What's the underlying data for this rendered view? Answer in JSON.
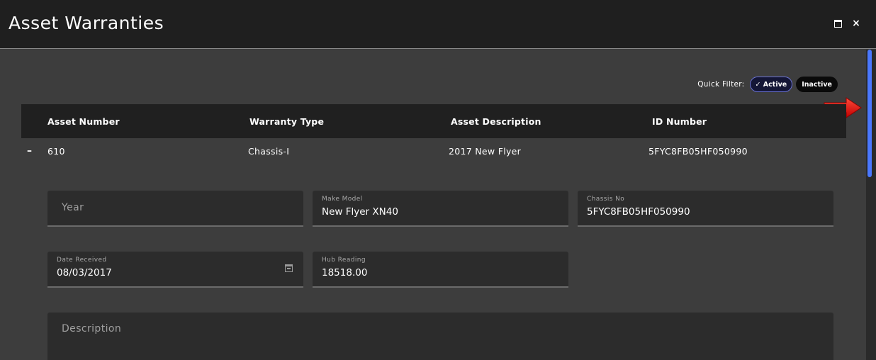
{
  "window": {
    "title": "Asset Warranties",
    "maximize_icon": "maximize-icon",
    "close_label": "×"
  },
  "quick_filter": {
    "label": "Quick Filter:",
    "active_label": "✓ Active",
    "inactive_label": "Inactive"
  },
  "grid": {
    "columns": [
      "Asset Number",
      "Warranty Type",
      "Asset Description",
      "ID Number"
    ],
    "row": {
      "toggle": "–",
      "asset_number": "610",
      "warranty_type": "Chassis-I",
      "asset_description": "2017 New Flyer",
      "id_number": "5FYC8FB05HF050990"
    }
  },
  "detail": {
    "year": {
      "placeholder": "Year"
    },
    "make_model": {
      "label": "Make Model",
      "value": "New Flyer XN40"
    },
    "chassis_no": {
      "label": "Chassis No",
      "value": "5FYC8FB05HF050990"
    },
    "date_received": {
      "label": "Date Received",
      "value": "08/03/2017"
    },
    "hub_reading": {
      "label": "Hub Reading",
      "value": "18518.00"
    },
    "description": {
      "placeholder": "Description"
    }
  },
  "colors": {
    "accent": "#4a78ff",
    "annotation_arrow": "#e01010",
    "active_chip_border": "#6b73d6"
  }
}
